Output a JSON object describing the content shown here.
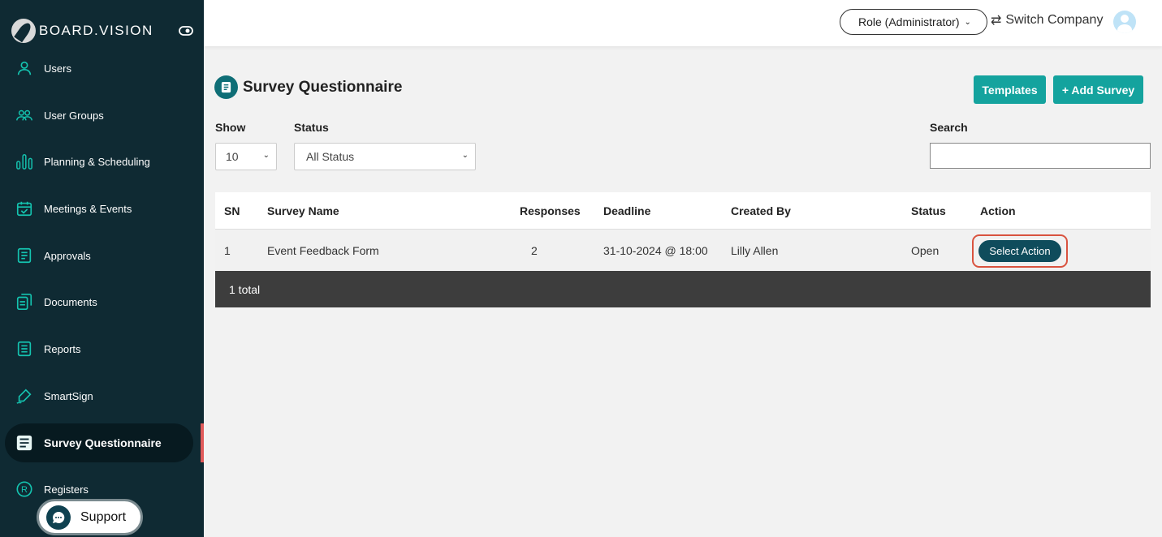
{
  "brand": {
    "name": "BOARD.VISION"
  },
  "sidebar": {
    "items": [
      {
        "label": "Users",
        "icon": "user-icon"
      },
      {
        "label": "User Groups",
        "icon": "users-icon"
      },
      {
        "label": "Planning & Scheduling",
        "icon": "bars-chart-icon"
      },
      {
        "label": "Meetings & Events",
        "icon": "calendar-icon"
      },
      {
        "label": "Approvals",
        "icon": "approval-document-icon"
      },
      {
        "label": "Documents",
        "icon": "documents-icon"
      },
      {
        "label": "Reports",
        "icon": "report-list-icon"
      },
      {
        "label": "SmartSign",
        "icon": "signature-pen-icon"
      },
      {
        "label": "Survey Questionnaire",
        "icon": "survey-icon",
        "active": true
      },
      {
        "label": "Registers",
        "icon": "registered-icon"
      }
    ],
    "support_label": "Support"
  },
  "topbar": {
    "role_label": "Role (Administrator)",
    "switch_label": "Switch Company"
  },
  "main": {
    "title": "Survey Questionnaire",
    "templates_label": "Templates",
    "add_survey_label": "+ Add Survey",
    "show_label": "Show",
    "show_value": "10",
    "status_label": "Status",
    "status_value": "All Status",
    "search_label": "Search",
    "search_value": ""
  },
  "table": {
    "headers": [
      "SN",
      "Survey Name",
      "Responses",
      "Deadline",
      "Created By",
      "Status",
      "Action"
    ],
    "rows": [
      {
        "sn": "1",
        "name": "Event Feedback Form",
        "responses": "2",
        "deadline": "31-10-2024 @ 18:00",
        "created_by": "Lilly Allen",
        "status": "Open",
        "action": "Select Action"
      }
    ],
    "footer": "1 total"
  },
  "colors": {
    "sidebar_bg": "#0f2a33",
    "accent": "#14a39e",
    "action_button": "#0f4c5c",
    "highlight_ring": "#d9533f"
  }
}
